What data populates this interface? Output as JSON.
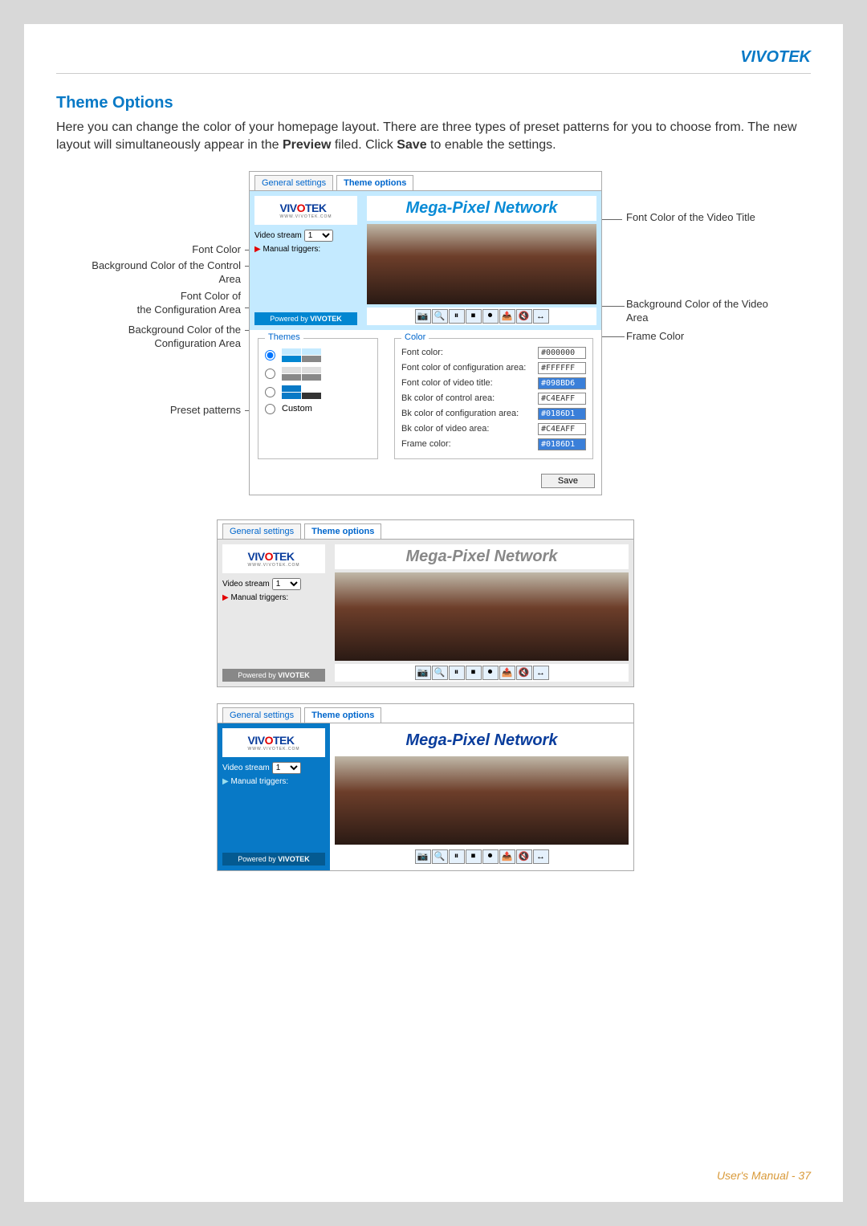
{
  "header": {
    "brand": "VIVOTEK"
  },
  "section": {
    "title": "Theme Options",
    "body_pre": "Here you can change the color of your homepage layout. There are three types of preset patterns for you to choose from. The new layout will simultaneously appear in the ",
    "body_bold1": "Preview",
    "body_mid": " filed. Click ",
    "body_bold2": "Save",
    "body_post": " to enable the settings."
  },
  "tabs": {
    "general": "General settings",
    "theme": "Theme options"
  },
  "logo": {
    "main1": "VIV",
    "main2": "O",
    "main3": "TEK",
    "sub": "WWW.VIVOTEK.COM"
  },
  "sidebar": {
    "video_stream_label": "Video stream",
    "video_stream_value": "1",
    "manual_triggers": "Manual triggers:",
    "powered_prefix": "Powered by ",
    "powered_brand": "VIVOTEK"
  },
  "video_title": "Mega-Pixel Network",
  "themes_label": "Themes",
  "custom_label": "Custom",
  "color_label": "Color",
  "color_rows": [
    {
      "label": "Font color:",
      "value": "#000000",
      "hl": false
    },
    {
      "label": "Font color of configuration area:",
      "value": "#FFFFFF",
      "hl": false
    },
    {
      "label": "Font color of video title:",
      "value": "#098BD6",
      "hl": true
    },
    {
      "label": "Bk color of control area:",
      "value": "#C4EAFF",
      "hl": false
    },
    {
      "label": "Bk color of configuration area:",
      "value": "#0186D1",
      "hl": true
    },
    {
      "label": "Bk color of video area:",
      "value": "#C4EAFF",
      "hl": false
    },
    {
      "label": "Frame color:",
      "value": "#0186D1",
      "hl": true
    }
  ],
  "save_label": "Save",
  "callouts": {
    "font_color": "Font Color",
    "bg_control": "Background Color of the Control Area",
    "font_config": "Font Color of\nthe Configuration Area",
    "bg_config": "Background Color of the Configuration Area",
    "preset": "Preset patterns",
    "font_video_title": "Font Color of the Video Title",
    "bg_video": "Background Color of the Video Area",
    "frame_color": "Frame Color"
  },
  "toolbar_icons": [
    "📷",
    "🔍",
    "⏸",
    "⏹",
    "⏺",
    "📤",
    "🔇",
    "↔"
  ],
  "footer": "User's Manual - 37"
}
